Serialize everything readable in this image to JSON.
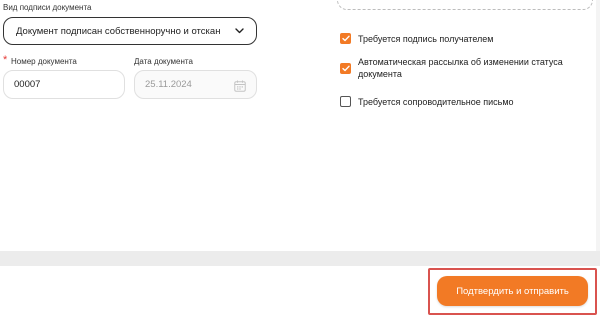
{
  "form": {
    "signature_type": {
      "label": "Вид подписи документа",
      "value": "Документ подписан собственноручно и отскан"
    },
    "doc_number": {
      "label": "Номер документа",
      "required_mark": "*",
      "value": "00007"
    },
    "doc_date": {
      "label": "Дата документа",
      "value": "25.11.2024"
    }
  },
  "options": [
    {
      "label": "Требуется подпись получателем",
      "checked": true
    },
    {
      "label": "Автоматическая рассылка об изменении статуса документа",
      "checked": true
    },
    {
      "label": "Требуется сопроводительное письмо",
      "checked": false
    }
  ],
  "actions": {
    "submit_label": "Подтвердить и отправить"
  },
  "colors": {
    "accent": "#f27a25",
    "highlight": "#d9534f"
  }
}
